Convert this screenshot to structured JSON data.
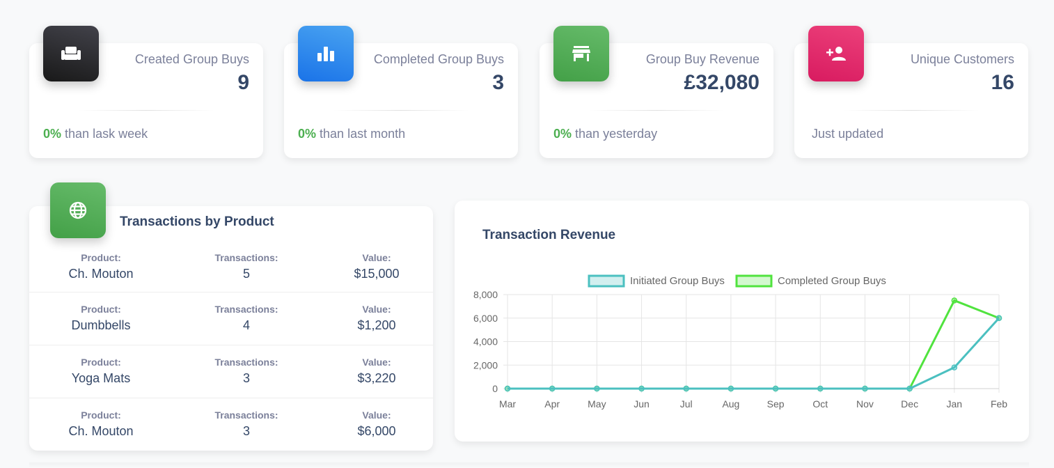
{
  "stats": [
    {
      "label": "Created Group Buys",
      "value": "9",
      "pct": "0%",
      "footer": "than lask week",
      "icon": "weekend-icon",
      "color": "#191919"
    },
    {
      "label": "Completed Group Buys",
      "value": "3",
      "pct": "0%",
      "footer": "than last month",
      "icon": "bar-chart-icon",
      "color": "#1a73e8"
    },
    {
      "label": "Group Buy Revenue",
      "value": "£32,080",
      "pct": "0%",
      "footer": "than yesterday",
      "icon": "store-icon",
      "color": "#43a047"
    },
    {
      "label": "Unique Customers",
      "value": "16",
      "pct": "",
      "footer": "Just updated",
      "icon": "person-add-icon",
      "color": "#d81b60"
    }
  ],
  "products": {
    "title": "Transactions by Product",
    "icon": "globe-icon",
    "headers": {
      "product": "Product:",
      "transactions": "Transactions:",
      "value": "Value:"
    },
    "rows": [
      {
        "product": "Ch. Mouton",
        "transactions": "5",
        "value": "$15,000"
      },
      {
        "product": "Dumbbells",
        "transactions": "4",
        "value": "$1,200"
      },
      {
        "product": "Yoga Mats",
        "transactions": "3",
        "value": "$3,220"
      },
      {
        "product": "Ch. Mouton",
        "transactions": "3",
        "value": "$6,000"
      }
    ]
  },
  "revenue": {
    "title": "Transaction Revenue",
    "chart_data": {
      "type": "line",
      "title": "",
      "xlabel": "",
      "ylabel": "",
      "categories": [
        "Mar",
        "Apr",
        "May",
        "Jun",
        "Jul",
        "Aug",
        "Sep",
        "Oct",
        "Nov",
        "Dec",
        "Jan",
        "Feb"
      ],
      "series": [
        {
          "name": "Initiated Group Buys",
          "color": "#4bc0c0",
          "values": [
            0,
            0,
            0,
            0,
            0,
            0,
            0,
            0,
            0,
            0,
            1800,
            6000
          ]
        },
        {
          "name": "Completed Group Buys",
          "color": "#50e33e",
          "values": [
            0,
            0,
            0,
            0,
            0,
            0,
            0,
            0,
            0,
            0,
            7500,
            6000
          ]
        }
      ],
      "ylim": [
        0,
        8000
      ],
      "yticks": [
        "8,000",
        "6,000",
        "4,000",
        "2,000",
        "0"
      ],
      "legend": "top",
      "grid": true
    }
  }
}
